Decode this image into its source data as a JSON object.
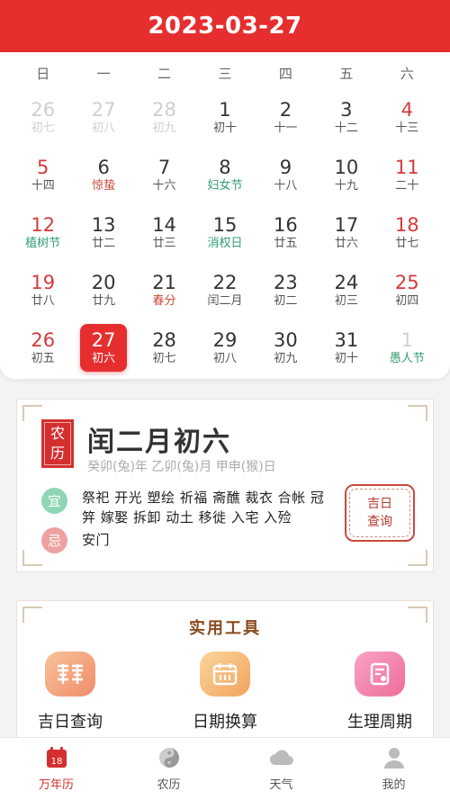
{
  "header": {
    "title": "2023-03-27"
  },
  "weekdays": [
    "日",
    "一",
    "二",
    "三",
    "四",
    "五",
    "六"
  ],
  "days": [
    {
      "num": "26",
      "lunar": "初七",
      "other": true
    },
    {
      "num": "27",
      "lunar": "初八",
      "other": true
    },
    {
      "num": "28",
      "lunar": "初九",
      "other": true
    },
    {
      "num": "1",
      "lunar": "初十"
    },
    {
      "num": "2",
      "lunar": "十一"
    },
    {
      "num": "3",
      "lunar": "十二"
    },
    {
      "num": "4",
      "lunar": "十三",
      "weekend": true
    },
    {
      "num": "5",
      "lunar": "十四",
      "weekend": true
    },
    {
      "num": "6",
      "lunar": "惊蛰",
      "kind": "term"
    },
    {
      "num": "7",
      "lunar": "十六"
    },
    {
      "num": "8",
      "lunar": "妇女节",
      "kind": "fest"
    },
    {
      "num": "9",
      "lunar": "十八"
    },
    {
      "num": "10",
      "lunar": "十九"
    },
    {
      "num": "11",
      "lunar": "二十",
      "weekend": true
    },
    {
      "num": "12",
      "lunar": "植树节",
      "kind": "fest",
      "weekend": true
    },
    {
      "num": "13",
      "lunar": "廿二"
    },
    {
      "num": "14",
      "lunar": "廿三"
    },
    {
      "num": "15",
      "lunar": "消权日",
      "kind": "fest"
    },
    {
      "num": "16",
      "lunar": "廿五"
    },
    {
      "num": "17",
      "lunar": "廿六"
    },
    {
      "num": "18",
      "lunar": "廿七",
      "weekend": true
    },
    {
      "num": "19",
      "lunar": "廿八",
      "weekend": true
    },
    {
      "num": "20",
      "lunar": "廿九"
    },
    {
      "num": "21",
      "lunar": "春分",
      "kind": "term"
    },
    {
      "num": "22",
      "lunar": "闰二月"
    },
    {
      "num": "23",
      "lunar": "初二"
    },
    {
      "num": "24",
      "lunar": "初三"
    },
    {
      "num": "25",
      "lunar": "初四",
      "weekend": true
    },
    {
      "num": "26",
      "lunar": "初五",
      "weekend": true
    },
    {
      "num": "27",
      "lunar": "初六",
      "selected": true
    },
    {
      "num": "28",
      "lunar": "初七"
    },
    {
      "num": "29",
      "lunar": "初八"
    },
    {
      "num": "30",
      "lunar": "初九"
    },
    {
      "num": "31",
      "lunar": "初十"
    },
    {
      "num": "1",
      "lunar": "愚人节",
      "kind": "fest",
      "other": true
    }
  ],
  "almanac": {
    "badge_top": "农",
    "badge_bottom": "历",
    "lunar_date": "闰二月初六",
    "ganzhi": "癸卯(兔)年 乙卯(兔)月 甲申(猴)日",
    "yi_label": "宜",
    "yi_items": "祭祀 开光 塑绘 祈福 斋醮 裁衣 合帐 冠笄 嫁娶 拆卸 动土 移徙 入宅 入殓",
    "ji_label": "忌",
    "ji_items": "安门",
    "stamp_line1": "吉日",
    "stamp_line2": "查询"
  },
  "tools": {
    "title": "实用工具",
    "items": [
      {
        "label": "吉日查询",
        "icon": "double-happiness-icon"
      },
      {
        "label": "日期换算",
        "icon": "calendar-icon"
      },
      {
        "label": "生理周期",
        "icon": "cycle-icon"
      }
    ]
  },
  "tabbar": {
    "items": [
      {
        "label": "万年历",
        "icon": "calendar-icon",
        "active": true,
        "badge": "18"
      },
      {
        "label": "农历",
        "icon": "yin-yang-icon"
      },
      {
        "label": "天气",
        "icon": "cloud-icon"
      },
      {
        "label": "我的",
        "icon": "user-icon"
      }
    ]
  },
  "colors": {
    "primary": "#e62e2e",
    "festival": "#2e9d6f",
    "weekend": "#d43b3b"
  }
}
